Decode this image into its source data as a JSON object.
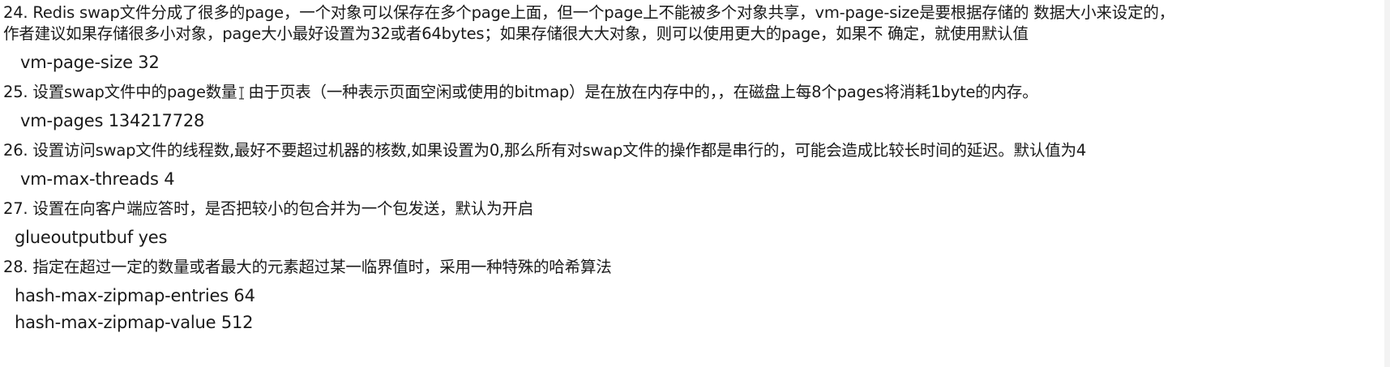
{
  "items": [
    {
      "desc_line1": "24. Redis swap文件分成了很多的page，一个对象可以保存在多个page上面，但一个page上不能被多个对象共享，vm-page-size是要根据存储的 数据大小来设定的，",
      "desc_line2": "作者建议如果存储很多小对象，page大小最好设置为32或者64bytes；如果存储很大大对象，则可以使用更大的page，如果不 确定，就使用默认值",
      "code": "vm-page-size 32"
    },
    {
      "desc_a": "25. 设置swap文件中的page数量",
      "desc_b": "由于页表（一种表示页面空闲或使用的bitmap）是在放在内存中的，，在磁盘上每8个pages将消耗1byte的内存。",
      "code": "vm-pages 134217728"
    },
    {
      "desc": "26. 设置访问swap文件的线程数,最好不要超过机器的核数,如果设置为0,那么所有对swap文件的操作都是串行的，可能会造成比较长时间的延迟。默认值为4",
      "code": "vm-max-threads 4"
    },
    {
      "desc": "27. 设置在向客户端应答时，是否把较小的包合并为一个包发送，默认为开启",
      "code": "glueoutputbuf yes"
    },
    {
      "desc": "28. 指定在超过一定的数量或者最大的元素超过某一临界值时，采用一种特殊的哈希算法",
      "code1": "hash-max-zipmap-entries 64",
      "code2": "hash-max-zipmap-value 512"
    }
  ]
}
